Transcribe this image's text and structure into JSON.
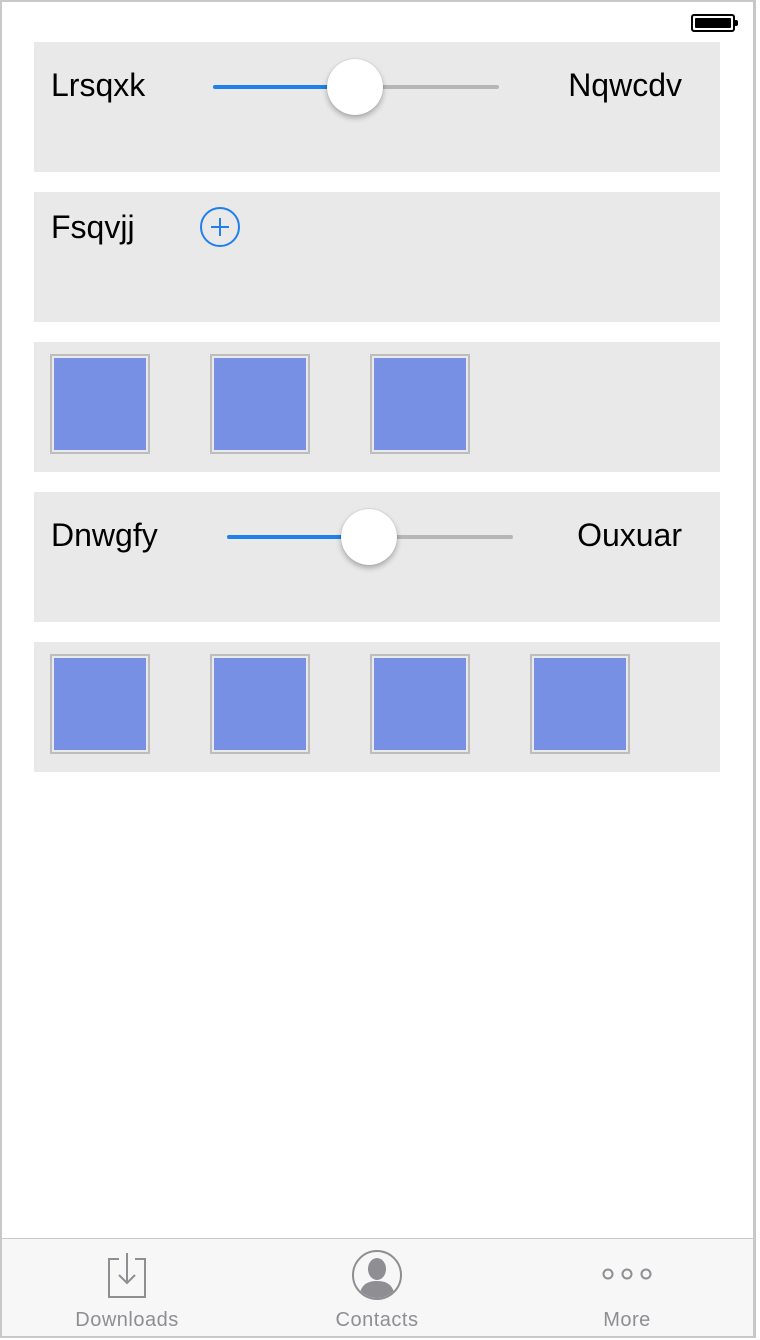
{
  "status_bar": {
    "battery_icon": "battery-full-icon"
  },
  "panels": {
    "slider1": {
      "left_label": "Lrsqxk",
      "right_label": "Nqwcdv",
      "value": 0.5
    },
    "add_row": {
      "label": "Fsqvjj",
      "icon": "plus-circle-icon"
    },
    "tiles1": {
      "count": 3
    },
    "slider2": {
      "left_label": "Dnwgfy",
      "right_label": "Ouxuar",
      "value": 0.5
    },
    "tiles2": {
      "count": 4
    }
  },
  "tab_bar": {
    "items": [
      {
        "label": "Downloads",
        "icon": "downloads-icon"
      },
      {
        "label": "Contacts",
        "icon": "contacts-icon"
      },
      {
        "label": "More",
        "icon": "more-icon"
      }
    ]
  },
  "colors": {
    "accent": "#1f80ec",
    "tile_fill": "#7890e4",
    "panel_bg": "#e9e9e9"
  }
}
